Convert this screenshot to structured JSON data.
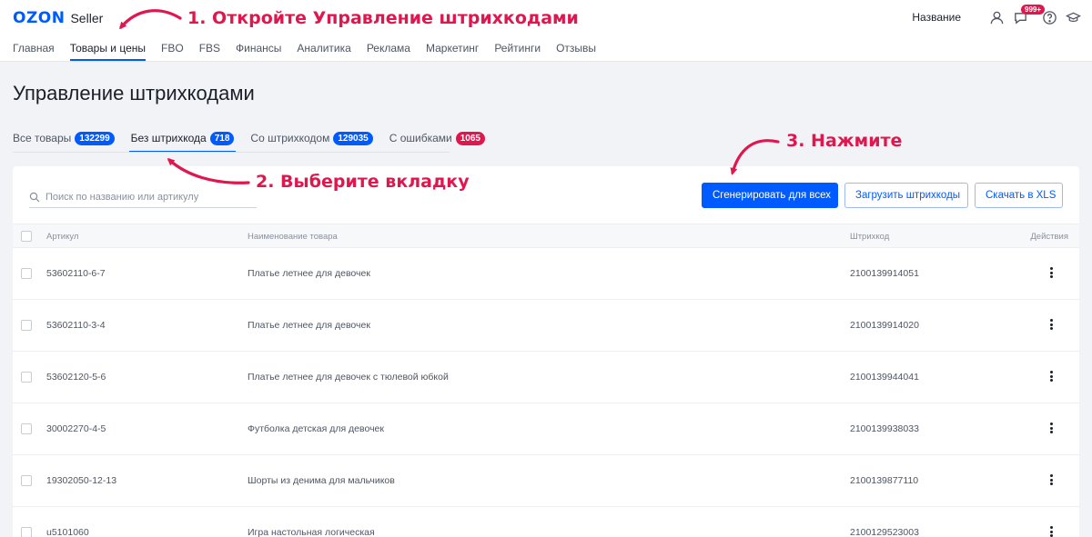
{
  "header": {
    "logo_brand": "OZON",
    "logo_product": "Seller",
    "account_name": "Название",
    "messages_badge": "999+"
  },
  "nav": [
    {
      "label": "Главная",
      "active": false
    },
    {
      "label": "Товары и цены",
      "active": true
    },
    {
      "label": "FBO",
      "active": false
    },
    {
      "label": "FBS",
      "active": false
    },
    {
      "label": "Финансы",
      "active": false
    },
    {
      "label": "Аналитика",
      "active": false
    },
    {
      "label": "Реклама",
      "active": false
    },
    {
      "label": "Маркетинг",
      "active": false
    },
    {
      "label": "Рейтинги",
      "active": false
    },
    {
      "label": "Отзывы",
      "active": false
    }
  ],
  "page": {
    "title": "Управление штрихкодами"
  },
  "tabs": [
    {
      "label": "Все товары",
      "count": "132299",
      "active": false,
      "badge_color": "#005bff"
    },
    {
      "label": "Без штрихкода",
      "count": "718",
      "active": true,
      "badge_color": "#005bff"
    },
    {
      "label": "Со штрихкодом",
      "count": "129035",
      "active": false,
      "badge_color": "#005bff"
    },
    {
      "label": "С ошибками",
      "count": "1065",
      "active": false,
      "badge_color": "#e0174e"
    }
  ],
  "toolbar": {
    "search_placeholder": "Поиск по названию или артикулу",
    "search_value": "",
    "generate_label": "Сгенерировать для всех",
    "upload_label": "Загрузить штрихкоды",
    "download_label": "Скачать в XLS"
  },
  "table": {
    "columns": {
      "article": "Артикул",
      "name": "Наименование товара",
      "barcode": "Штрихкод",
      "actions": "Действия"
    },
    "rows": [
      {
        "article": "53602110-6-7",
        "name": "Платье летнее для девочек",
        "barcode": "2100139914051"
      },
      {
        "article": "53602110-3-4",
        "name": "Платье летнее для девочек",
        "barcode": "2100139914020"
      },
      {
        "article": "53602120-5-6",
        "name": "Платье летнее для девочек с тюлевой юбкой",
        "barcode": "2100139944041"
      },
      {
        "article": "30002270-4-5",
        "name": "Футболка детская для девочек",
        "barcode": "2100139938033"
      },
      {
        "article": "19302050-12-13",
        "name": "Шорты из денима для мальчиков",
        "barcode": "2100139877110"
      },
      {
        "article": "u5101060",
        "name": "Игра настольная логическая",
        "barcode": "2100129523003"
      }
    ]
  },
  "annotations": {
    "step1": "1. Откройте Управление штрихкодами",
    "step2": "2. Выберите вкладку",
    "step3": "3. Нажмите"
  },
  "colors": {
    "accent": "#005bff",
    "annotation": "#e0174e"
  }
}
